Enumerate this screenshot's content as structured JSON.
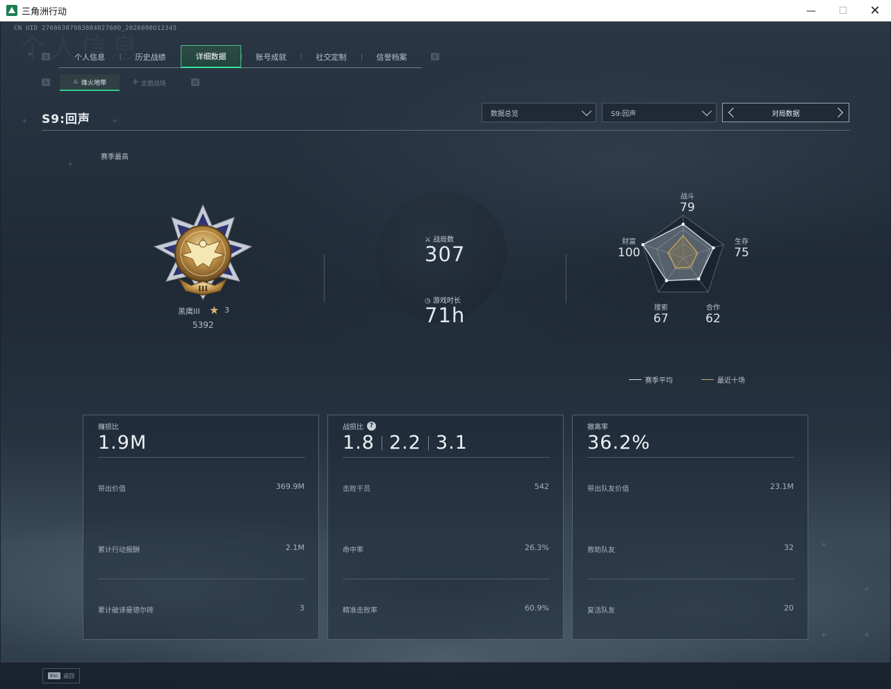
{
  "window": {
    "title": "三角洲行动",
    "minimize": "—",
    "maximize": "☐",
    "close": "✕"
  },
  "header": {
    "uid": "CN UID 2760638798388402760O_2026080O12345",
    "watermark": "个人信息"
  },
  "main_tabs": {
    "left_key": "Q",
    "right_key": "E",
    "items": [
      {
        "label": "个人信息",
        "active": false
      },
      {
        "label": "历史战绩",
        "active": false
      },
      {
        "label": "详细数据",
        "active": true
      },
      {
        "label": "账号成就",
        "active": false
      },
      {
        "label": "社交定制",
        "active": false
      },
      {
        "label": "信誉档案",
        "active": false
      }
    ]
  },
  "sub_tabs": {
    "left_key": "A",
    "right_key": "D",
    "items": [
      {
        "label": "烽火地带",
        "icon": "fire-zone-icon",
        "active": true
      },
      {
        "label": "全面战场",
        "icon": "battlefield-icon",
        "active": false
      }
    ]
  },
  "season": {
    "title": "S9:回声",
    "best_label": "赛季最高"
  },
  "filters": {
    "view_select": "数据总览",
    "season_select": "S9:回声",
    "pager_label": "对局数据"
  },
  "rank": {
    "name": "黑鹰III",
    "stars": "3",
    "score": "5392",
    "badge_numeral": "III"
  },
  "summary": {
    "matches_label": "战局数",
    "matches_value": "307",
    "playtime_label": "游戏时长",
    "playtime_value": "71h"
  },
  "radar": {
    "axes": [
      {
        "label": "战斗",
        "value": "79"
      },
      {
        "label": "生存",
        "value": "75"
      },
      {
        "label": "合作",
        "value": "62"
      },
      {
        "label": "搜索",
        "value": "67"
      },
      {
        "label": "财富",
        "value": "100"
      }
    ],
    "season_avg_values": [
      79,
      75,
      62,
      67,
      100
    ],
    "recent_ten_values": [
      52,
      36,
      28,
      30,
      38
    ],
    "legend_season_avg": "赛季平均",
    "legend_recent_ten": "最近十场",
    "color_season_avg": "#d8dee4",
    "color_recent_ten": "#c9a85a"
  },
  "cards": [
    {
      "head_label": "赚损比",
      "head_values": [
        "1.9M"
      ],
      "rows": [
        {
          "label": "带出价值",
          "value": "369.9M"
        },
        {
          "label": "累计行动报酬",
          "value": "2.1M"
        },
        {
          "label": "累计破译曼德尔砖",
          "value": "3"
        }
      ]
    },
    {
      "head_label": "战损比",
      "head_values": [
        "1.8",
        "2.2",
        "3.1"
      ],
      "rows": [
        {
          "label": "击败干员",
          "value": "542"
        },
        {
          "label": "命中率",
          "value": "26.3%"
        },
        {
          "label": "精准击败率",
          "value": "60.9%"
        }
      ]
    },
    {
      "head_label": "撤离率",
      "head_values": [
        "36.2%"
      ],
      "rows": [
        {
          "label": "带出队友价值",
          "value": "23.1M"
        },
        {
          "label": "救助队友",
          "value": "32"
        },
        {
          "label": "复活队友",
          "value": "20"
        }
      ]
    }
  ],
  "bottom": {
    "esc_key": "Esc",
    "back_label": "返回"
  },
  "colors": {
    "accent": "#34e39a",
    "background": "#1f2a36"
  }
}
